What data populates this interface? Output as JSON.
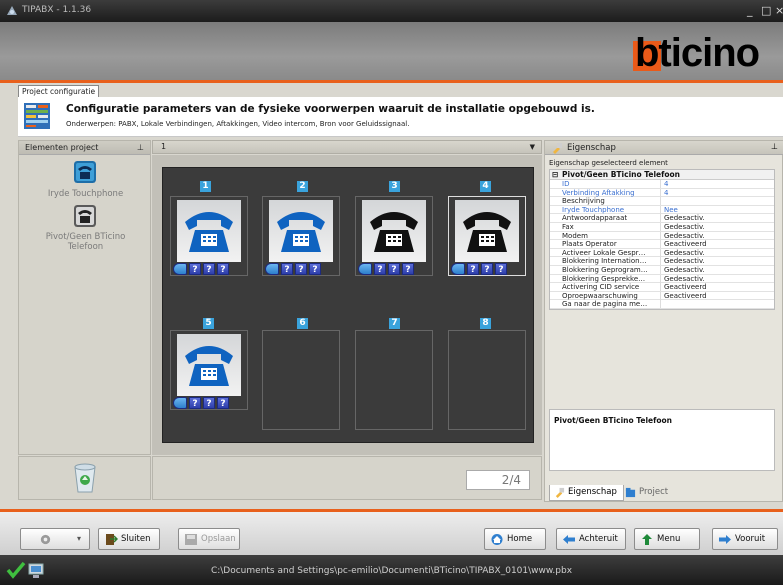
{
  "window": {
    "title": "TIPABX - 1.1.36",
    "controls": [
      "_",
      "□",
      "×"
    ]
  },
  "brand": {
    "logo_text": "bticino",
    "accent_color": "#e8601c"
  },
  "tabs": {
    "active": "Project configuratie"
  },
  "banner": {
    "title": "Configuratie parameters van de fysieke voorwerpen waaruit de installatie opgebouwd is.",
    "subtitle": "Onderwerpen: PABX, Lokale Verbindingen, Aftakkingen, Video intercom, Bron voor Geluidssignaal."
  },
  "left_panel": {
    "title": "Elementen project",
    "pin": "ᵖ",
    "items": [
      {
        "label": "Iryde Touchphone",
        "icon": "touchphone-icon"
      },
      {
        "label": "Pivot/Geen BTicino Telefoon",
        "icon": "desk-phone-icon"
      }
    ],
    "trash_icon": "recycle-bin-icon"
  },
  "center": {
    "dropdown_value": "1",
    "slots": [
      {
        "number": "1",
        "phone": "blue",
        "filled": true,
        "selected": false
      },
      {
        "number": "2",
        "phone": "blue",
        "filled": true,
        "selected": false
      },
      {
        "number": "3",
        "phone": "black",
        "filled": true,
        "selected": false
      },
      {
        "number": "4",
        "phone": "black",
        "filled": true,
        "selected": true
      },
      {
        "number": "5",
        "phone": "blue",
        "filled": true,
        "selected": false
      },
      {
        "number": "6",
        "filled": false
      },
      {
        "number": "7",
        "filled": false
      },
      {
        "number": "8",
        "filled": false
      }
    ],
    "question_label": "?",
    "page_indicator": "2/4"
  },
  "right_panel": {
    "title": "Eigenschap",
    "subtitle": "Eigenschap geselecteerd element",
    "group": "Pivot/Geen BTicino Telefoon",
    "properties": [
      {
        "key": "ID",
        "value": "4",
        "highlight": true
      },
      {
        "key": "Verbinding Aftakking",
        "value": "4",
        "highlight": true
      },
      {
        "key": "Beschrijving",
        "value": "",
        "highlight": false
      },
      {
        "key": "Iryde Touchphone",
        "value": "Nee",
        "highlight": true
      },
      {
        "key": "Antwoordapparaat",
        "value": "Gedesactiv.",
        "highlight": false
      },
      {
        "key": "Fax",
        "value": "Gedesactiv.",
        "highlight": false
      },
      {
        "key": "Modem",
        "value": "Gedesactiv.",
        "highlight": false
      },
      {
        "key": "Plaats Operator",
        "value": "Geactiveerd",
        "highlight": false
      },
      {
        "key": "Activeer Lokale Gespr…",
        "value": "Gedesactiv.",
        "highlight": false
      },
      {
        "key": "Blokkering Internation…",
        "value": "Gedesactiv.",
        "highlight": false
      },
      {
        "key": "Blokkering Geprogram…",
        "value": "Gedesactiv.",
        "highlight": false
      },
      {
        "key": "Blokkering Gesprekke…",
        "value": "Gedesactiv.",
        "highlight": false
      },
      {
        "key": "Activering CID service",
        "value": "Geactiveerd",
        "highlight": false
      },
      {
        "key": "Oproepwaarschuwing",
        "value": "Geactiveerd",
        "highlight": false
      },
      {
        "key": "Ga naar de pagina me…",
        "value": "",
        "highlight": false
      }
    ],
    "description_title": "Pivot/Geen BTicino Telefoon",
    "tab_active": "Eigenschap",
    "tab_inactive": "Project"
  },
  "toolbar": {
    "close_label": "Sluiten",
    "save_label": "Opslaan",
    "home_label": "Home",
    "back_label": "Achteruit",
    "menu_label": "Menu",
    "forward_label": "Vooruit"
  },
  "status": {
    "path": "C:\\Documents and Settings\\pc-emilio\\Documenti\\BTicino\\TIPABX_0101\\www.pbx"
  }
}
